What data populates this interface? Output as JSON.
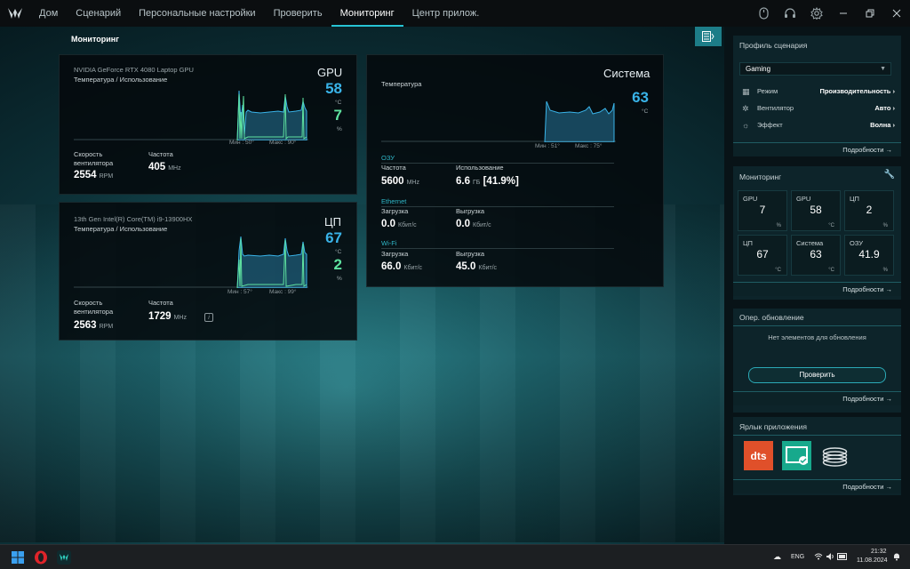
{
  "nav": {
    "items": [
      "Дом",
      "Сценарий",
      "Персональные настройки",
      "Проверить",
      "Мониторинг",
      "Центр прилож."
    ],
    "active_index": 4
  },
  "page_title": "Мониторинг",
  "gpu_card": {
    "device": "NVIDIA GeForce RTX 4080 Laptop GPU",
    "subtitle": "Температура / Использование",
    "title": "GPU",
    "temp": "58",
    "temp_unit": "°C",
    "usage": "7",
    "usage_unit": "%",
    "min": "Мин : 50°",
    "max": "Макс : 90°",
    "fan_label": "Скорость вентилятора",
    "fan_value": "2554",
    "fan_unit": "RPM",
    "freq_label": "Частота",
    "freq_value": "405",
    "freq_unit": "MHz"
  },
  "cpu_card": {
    "device": "13th Gen Intel(R) Core(TM) i9-13900HX",
    "subtitle": "Температура / Использование",
    "title": "ЦП",
    "temp": "67",
    "temp_unit": "°C",
    "usage": "2",
    "usage_unit": "%",
    "min": "Мин : 57°",
    "max": "Макс : 99°",
    "fan_label": "Скорость вентилятора",
    "fan_value": "2563",
    "fan_unit": "RPM",
    "freq_label": "Частота",
    "freq_value": "1729",
    "freq_unit": "MHz"
  },
  "system_card": {
    "title": "Система",
    "temp_label": "Температура",
    "temp": "63",
    "temp_unit": "°C",
    "min": "Мин : 51°",
    "max": "Макс : 75°",
    "ram_title": "ОЗУ",
    "ram_freq_label": "Частота",
    "ram_freq_value": "5600",
    "ram_freq_unit": "MHz",
    "ram_usage_label": "Использование",
    "ram_usage_value": "6.6",
    "ram_usage_unit": "ГБ",
    "ram_usage_pct": "[41.9%]",
    "eth_title": "Ethernet",
    "eth_down_label": "Загрузка",
    "eth_down_value": "0.0",
    "eth_down_unit": "Кбит/с",
    "eth_up_label": "Выгрузка",
    "eth_up_value": "0.0",
    "eth_up_unit": "Кбит/с",
    "wifi_title": "Wi-Fi",
    "wifi_down_label": "Загрузка",
    "wifi_down_value": "66.0",
    "wifi_down_unit": "Кбит/с",
    "wifi_up_label": "Выгрузка",
    "wifi_up_value": "45.0",
    "wifi_up_unit": "Кбит/с"
  },
  "right_panel": {
    "profile": {
      "title": "Профиль сценария",
      "selected": "Gaming",
      "rows": [
        {
          "label": "Режим",
          "value": "Производительность"
        },
        {
          "label": "Вентилятор",
          "value": "Авто"
        },
        {
          "label": "Эффект",
          "value": "Волна"
        }
      ],
      "details": "Подробности"
    },
    "monitoring": {
      "title": "Мониторинг",
      "tiles": [
        {
          "label": "GPU",
          "value": "7",
          "unit": "%"
        },
        {
          "label": "GPU",
          "value": "58",
          "unit": "°C"
        },
        {
          "label": "ЦП",
          "value": "2",
          "unit": "%"
        },
        {
          "label": "ЦП",
          "value": "67",
          "unit": "°C"
        },
        {
          "label": "Система",
          "value": "63",
          "unit": "°C"
        },
        {
          "label": "ОЗУ",
          "value": "41.9",
          "unit": "%"
        }
      ],
      "details": "Подробности"
    },
    "updates": {
      "title": "Опер. обновление",
      "empty_text": "Нет элементов для обновления",
      "button": "Проверить",
      "details": "Подробности"
    },
    "shortcuts": {
      "title": "Ярлык приложения",
      "apps": [
        "dts-icon",
        "monitor-app-icon",
        "coil-app-icon"
      ],
      "dts_text": "dts",
      "details": "Подробности"
    }
  },
  "taskbar": {
    "lang": "ENG",
    "time": "21:32",
    "date": "11.08.2024"
  },
  "colors": {
    "accent": "#27c4d4",
    "temp_blue": "#39b3e8",
    "usage_green": "#5fe3a0"
  }
}
